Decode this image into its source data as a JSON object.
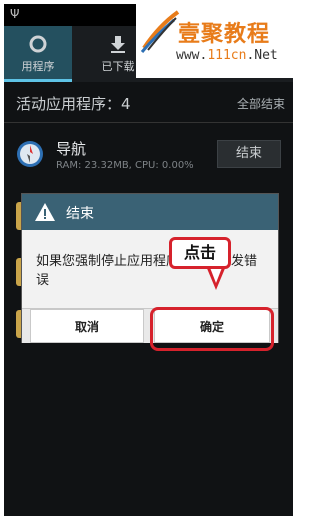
{
  "statusbar": {
    "usb_icon": "usb-icon"
  },
  "tabs": [
    {
      "label": "用程序",
      "icon": "circle-icon",
      "active": true
    },
    {
      "label": "已下载",
      "icon": "download-icon",
      "active": false
    }
  ],
  "watermark": {
    "title": "壹聚教程",
    "url_prefix": "www.",
    "url_mid": "111cn",
    "url_suffix": ".Net"
  },
  "header": {
    "running_label": "活动应用程序：4",
    "end_all_label": "全部结束"
  },
  "apps": [
    {
      "name": "导航",
      "meta": "RAM: 23.32MB, CPU: 0.00%",
      "end_label": "结束",
      "icon": "compass-icon"
    }
  ],
  "dialog": {
    "title": "结束",
    "message": "如果您强制停止应用程序，可能引发错误",
    "cancel_label": "取消",
    "ok_label": "确定",
    "icon": "warning-icon"
  },
  "annotation": {
    "callout_text": "点击"
  },
  "colors": {
    "accent": "#5ec3e6",
    "dialog_header": "#3a6275",
    "highlight": "#d6222c",
    "brand": "#e87c1a"
  }
}
